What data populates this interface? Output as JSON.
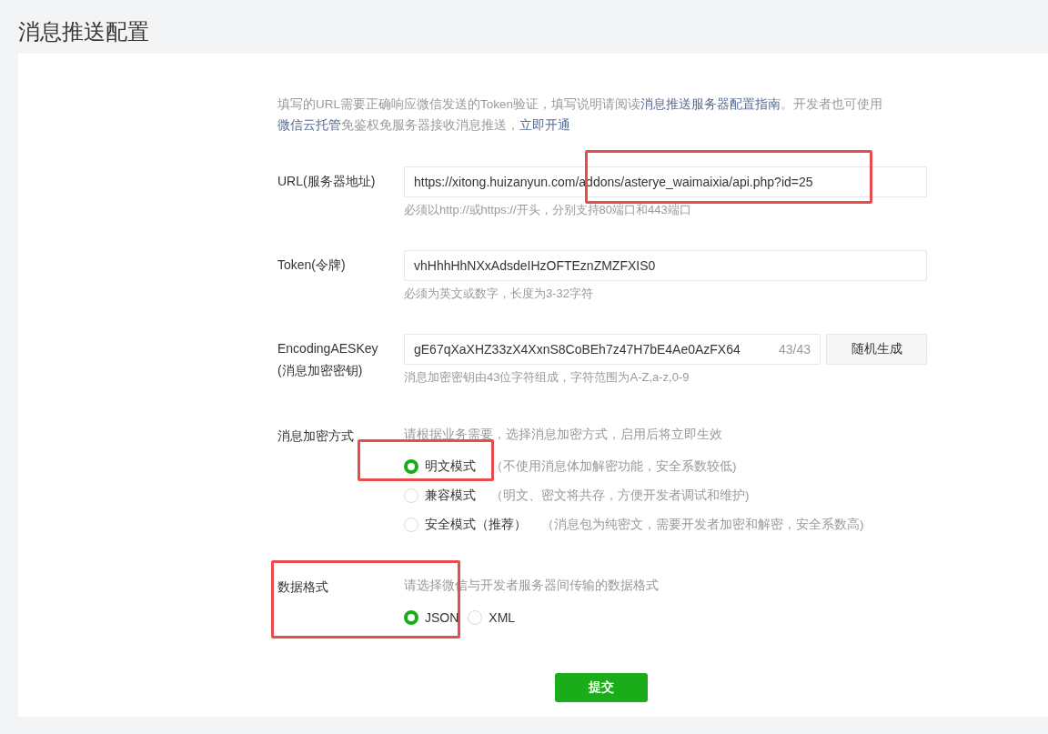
{
  "page_title": "消息推送配置",
  "intro": [
    {
      "kind": "text",
      "text": "填写的URL需要正确响应微信发送的Token验证，填写说明请阅读"
    },
    {
      "kind": "link",
      "text": "消息推送服务器配置指南"
    },
    {
      "kind": "text",
      "text": "。开发者也可使用"
    },
    {
      "kind": "link",
      "text": "微信云托管"
    },
    {
      "kind": "text",
      "text": "免鉴权免服务器接收消息推送，"
    },
    {
      "kind": "link",
      "text": "立即开通"
    }
  ],
  "fields": [
    {
      "label": "URL(服务器地址)",
      "value": "https://xitong.huizanyun.com/addons/asterye_waimaixia/api.php?id=25",
      "hint": "必须以http://或https://开头，分别支持80端口和443端口",
      "highlighted": true
    },
    {
      "label": "Token(令牌)",
      "value": "vhHhhHhNXxAdsdeIHzOFTEznZMZFXIS0",
      "hint": "必须为英文或数字，长度为3-32字符"
    },
    {
      "label": "EncodingAESKey",
      "sublabel": "(消息加密密钥)",
      "value": "gE67qXaXHZ33zX4XxnS8CoBEh7z47H7bE4Ae0AzFX64",
      "counter": "43/43",
      "button": "随机生成",
      "hint": "消息加密密钥由43位字符组成，字符范围为A-Z,a-z,0-9"
    }
  ],
  "encryption": {
    "label": "消息加密方式",
    "description": "请根据业务需要，选择消息加密方式，启用后将立即生效",
    "options": [
      {
        "label": "明文模式",
        "note": "（不使用消息体加解密功能，安全系数较低)",
        "selected": true,
        "highlighted": true
      },
      {
        "label": "兼容模式",
        "note": "（明文、密文将共存，方便开发者调试和维护)",
        "selected": false
      },
      {
        "label": "安全模式（推荐）",
        "note": "（消息包为纯密文，需要开发者加密和解密，安全系数高)",
        "selected": false
      }
    ]
  },
  "data_format": {
    "label": "数据格式",
    "description": "请选择微信与开发者服务器间传输的数据格式",
    "highlighted": true,
    "options": [
      {
        "label": "JSON",
        "selected": true
      },
      {
        "label": "XML",
        "selected": false
      }
    ]
  },
  "submit": "提交"
}
